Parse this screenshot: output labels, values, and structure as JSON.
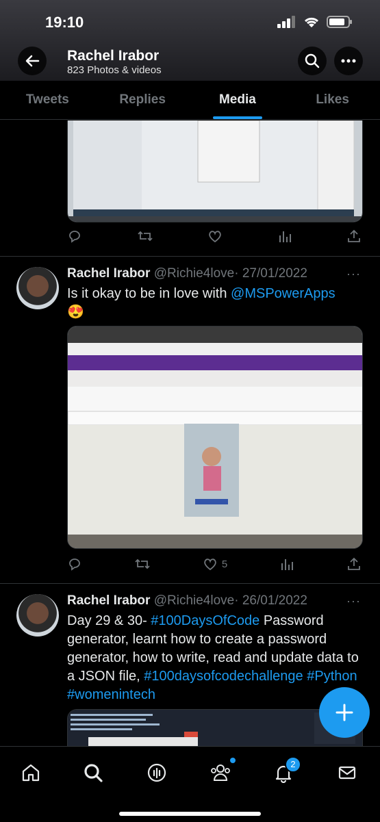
{
  "status": {
    "time": "19:10"
  },
  "header": {
    "name": "Rachel Irabor",
    "subtitle": "823 Photos & videos"
  },
  "tabs": [
    "Tweets",
    "Replies",
    "Media",
    "Likes"
  ],
  "active_tab": "Media",
  "tweet0": {
    "actions": {
      "reply": "",
      "retweet": "",
      "like": "",
      "views": ""
    }
  },
  "tweet1": {
    "name": "Rachel Irabor",
    "handle": "@Richie4love",
    "date": "· 27/01/2022",
    "text": "Is it okay to be in love with ",
    "mention": "@MSPowerApps",
    "emoji": "😍",
    "actions": {
      "like_count": "5"
    }
  },
  "tweet2": {
    "name": "Rachel Irabor",
    "handle": "@Richie4love",
    "date": "· 26/01/2022",
    "text_a": "Day 29 & 30- ",
    "tag1": "#100DaysOfCode",
    "text_b": " Password generator, learnt how to create a password generator, how to write, read and update data to a JSON file,  ",
    "tag2": "#100daysofcodechallenge",
    "tag3": "#Python",
    "tag4": "#womenintech"
  },
  "nav": {
    "notifications_badge": "2"
  },
  "colors": {
    "accent": "#1d9bf0",
    "background": "#000000",
    "muted": "#71767b"
  }
}
